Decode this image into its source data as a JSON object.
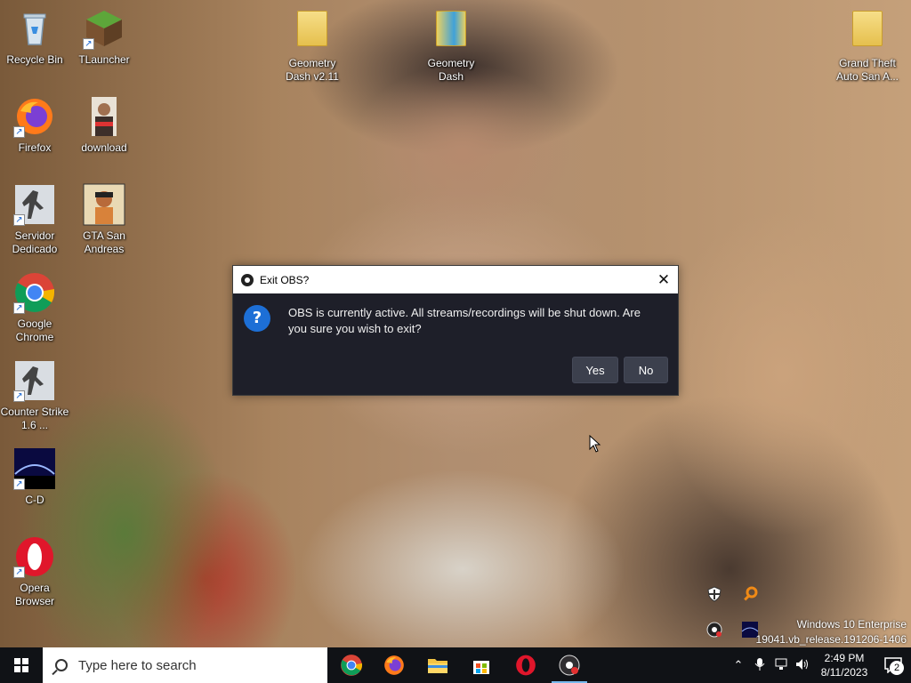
{
  "desktop": {
    "icons": [
      {
        "label": "Recycle Bin"
      },
      {
        "label": "TLauncher"
      },
      {
        "label": "Geometry Dash v2.11"
      },
      {
        "label": "Geometry Dash"
      },
      {
        "label": "Grand Theft Auto San A..."
      },
      {
        "label": "Firefox"
      },
      {
        "label": "download"
      },
      {
        "label": "Servidor Dedicado"
      },
      {
        "label": "GTA San Andreas"
      },
      {
        "label": "Google Chrome"
      },
      {
        "label": "Counter Strike 1.6 ..."
      },
      {
        "label": "C-D"
      },
      {
        "label": "Opera Browser"
      }
    ]
  },
  "dialog": {
    "title": "Exit OBS?",
    "message": "OBS is currently active. All streams/recordings will be shut down. Are you sure you wish to exit?",
    "yes_label": "Yes",
    "no_label": "No"
  },
  "watermark": {
    "line1": "Windows 10 Enterprise",
    "line2": "19041.vb_release.191206-1406"
  },
  "taskbar": {
    "search_placeholder": "Type here to search",
    "apps": [
      "Chrome",
      "Firefox",
      "File Explorer",
      "Microsoft Store",
      "Opera",
      "OBS Studio"
    ],
    "time": "2:49 PM",
    "date": "8/11/2023",
    "notification_count": "2"
  },
  "colors": {
    "dialog_bg": "#1e1f29",
    "button_bg": "#3c404d",
    "taskbar_bg": "#101216",
    "accent": "#1d6fd6"
  }
}
